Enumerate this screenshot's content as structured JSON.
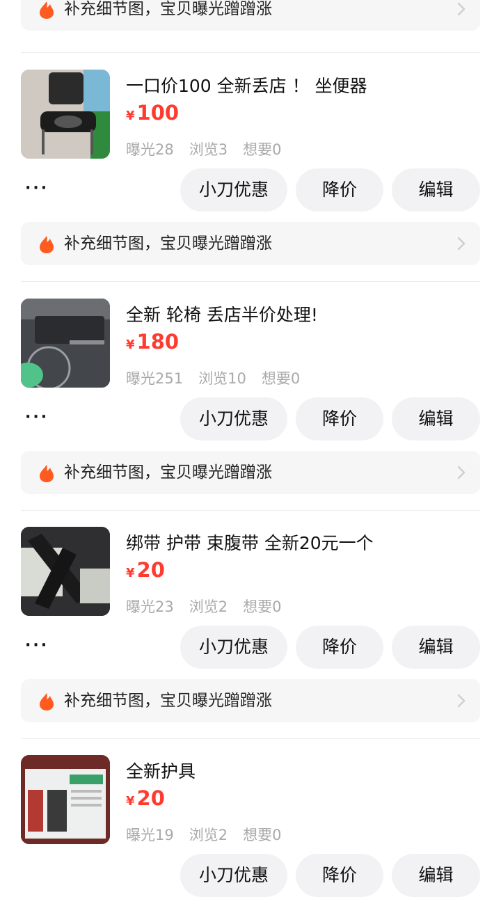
{
  "tip_text": "补充细节图，宝贝曝光蹭蹭涨",
  "buttons": {
    "coupon": "小刀优惠",
    "reduce": "降价",
    "edit": "编辑"
  },
  "more_label": "···",
  "currency": "¥",
  "items": [
    {
      "title": "一口价100 全新丢店 ！ 坐便器",
      "price": "100",
      "exposure": "曝光28",
      "views": "浏览3",
      "wants": "想要0"
    },
    {
      "title": "全新 轮椅 丢店半价处理!",
      "price": "180",
      "exposure": "曝光251",
      "views": "浏览10",
      "wants": "想要0"
    },
    {
      "title": "绑带 护带 束腹带 全新20元一个",
      "price": "20",
      "exposure": "曝光23",
      "views": "浏览2",
      "wants": "想要0"
    },
    {
      "title": "全新护具",
      "price": "20",
      "exposure": "曝光19",
      "views": "浏览2",
      "wants": "想要0"
    }
  ]
}
